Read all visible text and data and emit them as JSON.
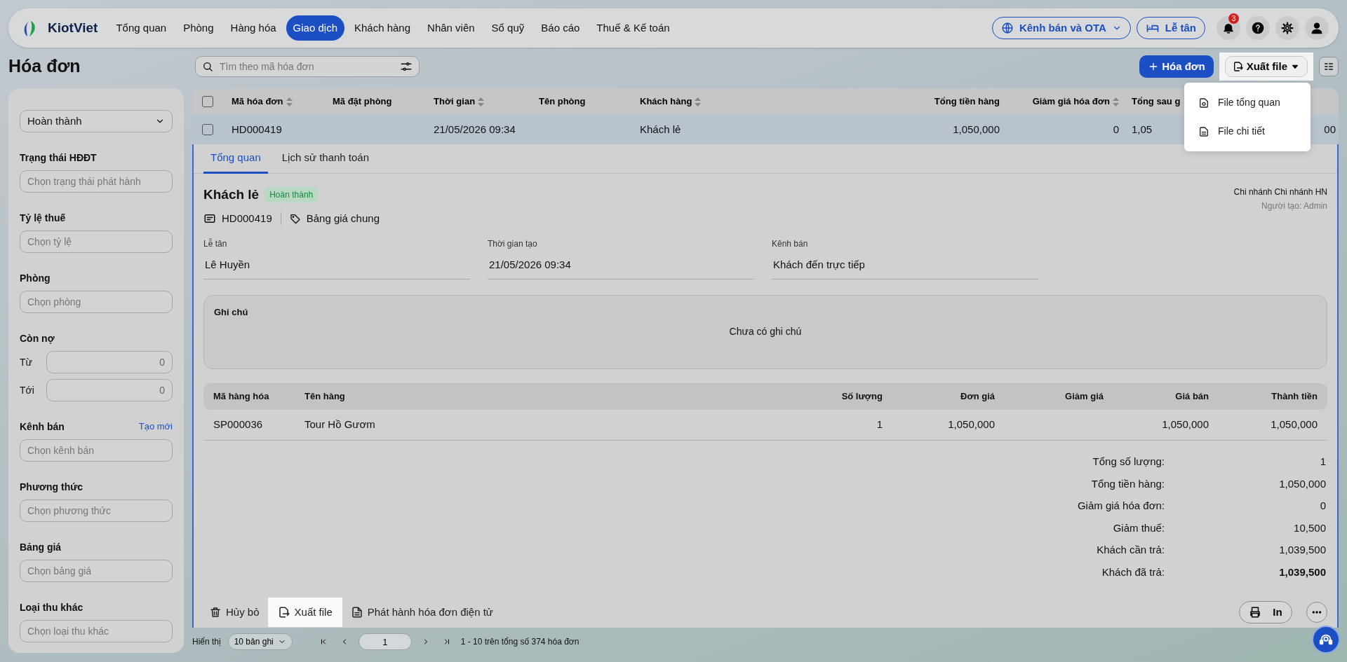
{
  "app": {
    "logo": "KiotViet"
  },
  "nav": [
    {
      "label": "Tổng quan",
      "selected": false
    },
    {
      "label": "Phòng",
      "selected": false
    },
    {
      "label": "Hàng hóa",
      "selected": false
    },
    {
      "label": "Giao dịch",
      "selected": true
    },
    {
      "label": "Khách hàng",
      "selected": false
    },
    {
      "label": "Nhân viên",
      "selected": false
    },
    {
      "label": "Sổ quỹ",
      "selected": false
    },
    {
      "label": "Báo cáo",
      "selected": false
    },
    {
      "label": "Thuế & Kế toán",
      "selected": false
    }
  ],
  "nav_right": {
    "channel_button": "Kênh bán và OTA",
    "reception_button": "Lễ tân",
    "notification_count": "3"
  },
  "page_title": "Hóa đơn",
  "search": {
    "placeholder": "Tìm theo mã hóa đơn"
  },
  "actions": {
    "add_button": "Hóa đơn",
    "export_button": "Xuất file"
  },
  "export_menu": [
    {
      "label": "File tổng quan",
      "kind": "overview"
    },
    {
      "label": "File chi tiết",
      "kind": "detail"
    }
  ],
  "filters": [
    {
      "kind": "select",
      "value": "Hoàn thành"
    },
    {
      "kind": "field",
      "label": "Trạng thái HĐĐT",
      "placeholder": "Chọn trạng thái phát hành"
    },
    {
      "kind": "field",
      "label": "Tỷ lệ thuế",
      "placeholder": "Chọn tỷ lệ"
    },
    {
      "kind": "field",
      "label": "Phòng",
      "placeholder": "Chọn phòng"
    },
    {
      "kind": "range",
      "label": "Còn nợ",
      "rows": [
        {
          "label": "Từ",
          "placeholder": "0"
        },
        {
          "label": "Tới",
          "placeholder": "0"
        }
      ]
    },
    {
      "kind": "field",
      "label": "Kênh bán",
      "link": "Tạo mới",
      "placeholder": "Chọn kênh bán"
    },
    {
      "kind": "field",
      "label": "Phương thức",
      "placeholder": "Chọn phương thức"
    },
    {
      "kind": "field",
      "label": "Bảng giá",
      "placeholder": "Chọn bảng giá"
    },
    {
      "kind": "field",
      "label": "Loại thu khác",
      "placeholder": "Chọn loại thu khác"
    }
  ],
  "table": {
    "select_all_checked": false,
    "columns": [
      {
        "label": "Mã hóa đơn",
        "sortable": true
      },
      {
        "label": "Mã đặt phòng",
        "sortable": false
      },
      {
        "label": "Thời gian",
        "sortable": true
      },
      {
        "label": "Tên phòng",
        "sortable": false
      },
      {
        "label": "Khách hàng",
        "sortable": true
      },
      {
        "label": "Tổng tiền hàng",
        "sortable": false
      },
      {
        "label": "Giảm giá hóa đơn",
        "sortable": true
      },
      {
        "label": "Tổng sau g",
        "sortable": false
      }
    ],
    "rows": [
      {
        "selected": true,
        "checked": false,
        "cells": [
          "HD000419",
          null,
          "21/05/2026 09:34",
          null,
          "Khách lẻ",
          "1,050,000",
          "0",
          "1,05",
          "00"
        ]
      }
    ]
  },
  "detail": {
    "tabs": [
      {
        "label": "Tổng quan",
        "selected": true
      },
      {
        "label": "Lịch sử thanh toán",
        "selected": false
      }
    ],
    "customer": "Khách lẻ",
    "status": "Hoàn thành",
    "code": "HD000419",
    "price_list": "Bảng giá chung",
    "branch": "Chi nhánh Chi nhánh HN",
    "creator": "Người tạo: Admin",
    "fields": [
      {
        "label": "Lễ tân",
        "value": "Lê Huyền"
      },
      {
        "label": "Thời gian tạo",
        "value": "21/05/2026 09:34"
      },
      {
        "label": "Kênh bán",
        "value": "Khách đến trực tiếp"
      }
    ],
    "note": {
      "title": "Ghi chú",
      "text": "Chưa có ghi chú"
    },
    "items": {
      "columns": [
        "Mã hàng hóa",
        "Tên hàng",
        "Số lượng",
        "Đơn giá",
        "Giảm giá",
        "Giá bán",
        "Thành tiền"
      ],
      "rows": [
        [
          "SP000036",
          "Tour Hồ Gươm",
          "1",
          "1,050,000",
          null,
          "1,050,000",
          "1,050,000"
        ]
      ]
    },
    "totals": [
      {
        "label": "Tổng số lượng:",
        "value": "1",
        "bold": false
      },
      {
        "label": "Tổng tiền hàng:",
        "value": "1,050,000",
        "bold": false
      },
      {
        "label": "Giảm giá hóa đơn:",
        "value": "0",
        "bold": false
      },
      {
        "label": "Giảm thuế:",
        "value": "10,500",
        "bold": false
      },
      {
        "label": "Khách cần trả:",
        "value": "1,039,500",
        "bold": false
      },
      {
        "label": "Khách đã trả:",
        "value": "1,039,500",
        "bold": true
      }
    ],
    "footer_actions": [
      {
        "label": "Hủy bỏ",
        "kind": "delete",
        "highlighted": false
      },
      {
        "label": "Xuất file",
        "kind": "export",
        "highlighted": true
      },
      {
        "label": "Phát hành hóa đơn điện tử",
        "kind": "document",
        "highlighted": false
      }
    ],
    "print_button": "In"
  },
  "pagination": {
    "label": "Hiển thị",
    "page_size": "10 bản ghi",
    "page": "1",
    "summary": "1 - 10 trên tổng số 374 hóa đơn"
  }
}
